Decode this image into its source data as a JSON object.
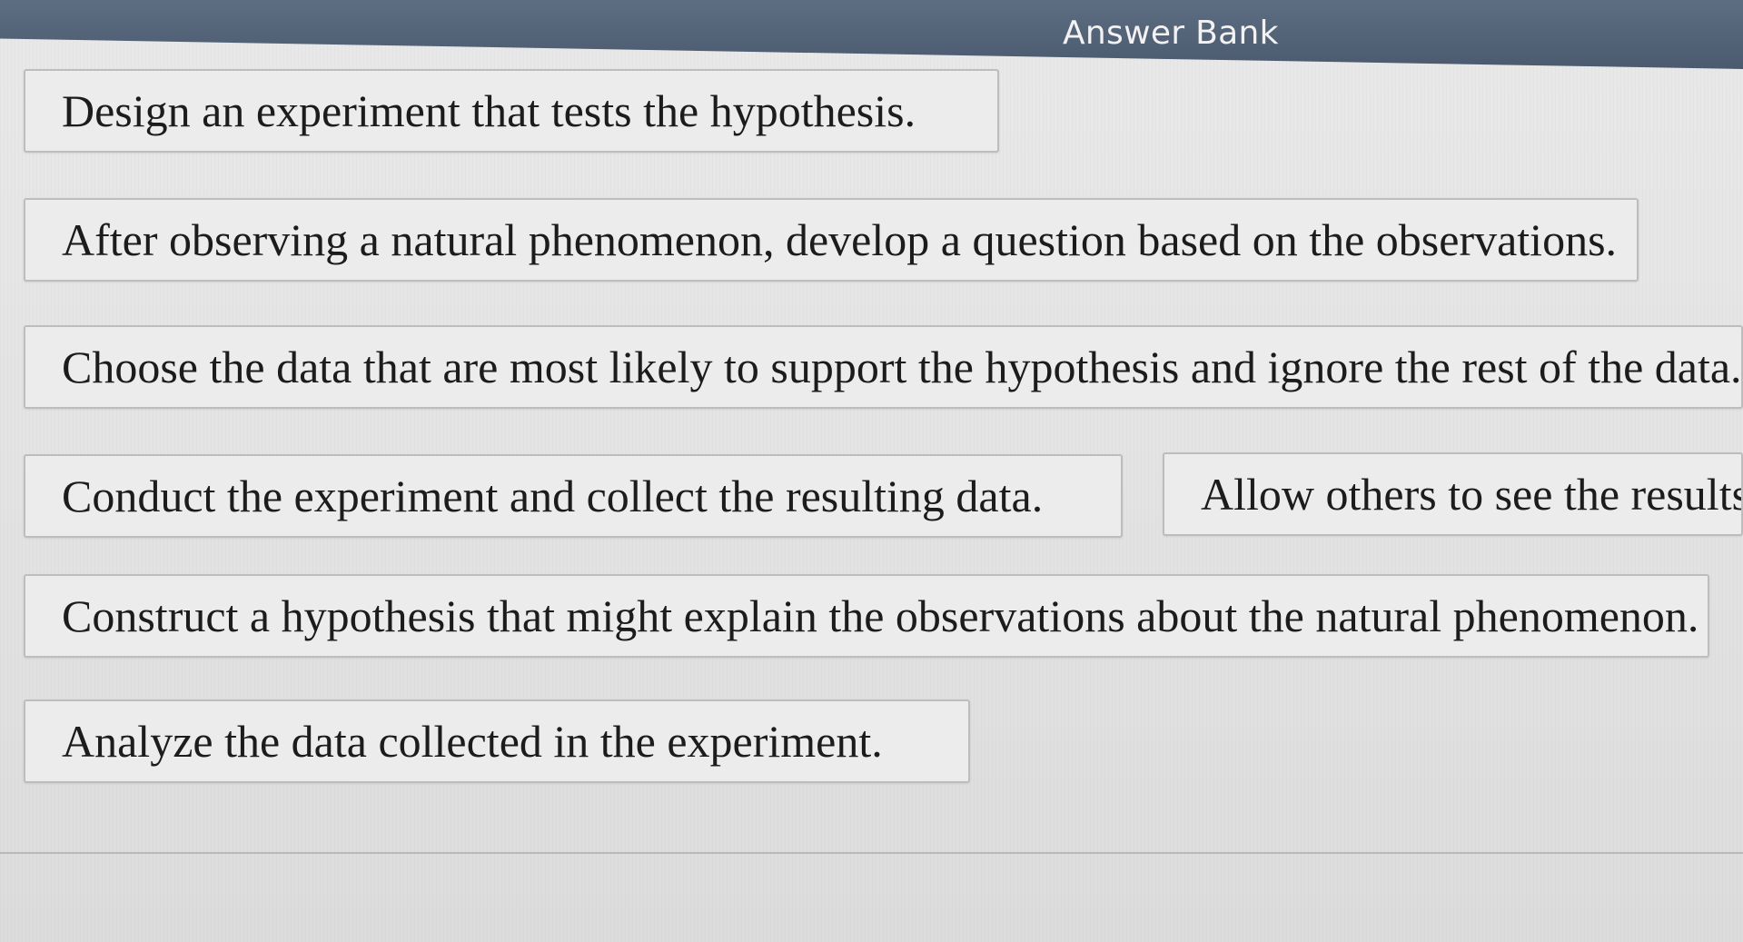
{
  "answer_bank": {
    "title": "Answer Bank",
    "items": [
      {
        "label": "Design an experiment that tests the hypothesis."
      },
      {
        "label": "After observing a natural phenomenon, develop a question based on the observations."
      },
      {
        "label": "Choose the data that are most likely to support the hypothesis and ignore the rest of the data."
      },
      {
        "label": "Conduct the experiment and collect the resulting data."
      },
      {
        "label": "Allow others to see the results of t"
      },
      {
        "label": "Construct a hypothesis that might explain the observations about the natural phenomenon."
      },
      {
        "label": "Analyze the data collected in the experiment."
      }
    ]
  }
}
